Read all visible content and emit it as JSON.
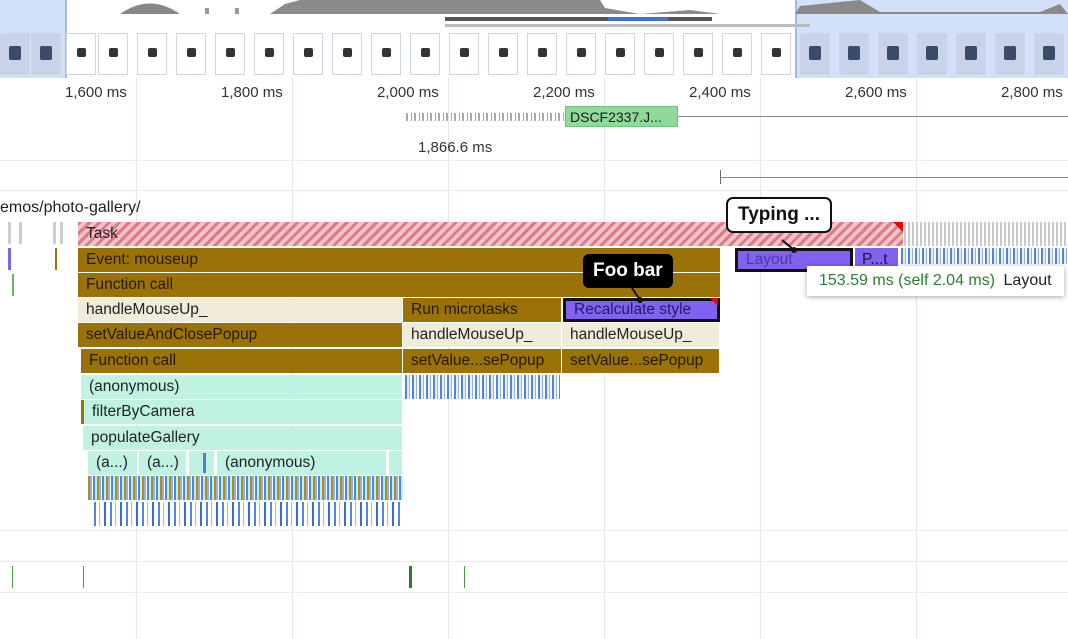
{
  "ruler": {
    "ticks": [
      "1,600 ms",
      "1,800 ms",
      "2,000 ms",
      "2,200 ms",
      "2,400 ms",
      "2,600 ms",
      "2,800 ms"
    ]
  },
  "network": {
    "request_label": "DSCF2337.J...",
    "duration_label": "1,866.6 ms"
  },
  "main_track": {
    "url_label": "emos/photo-gallery/"
  },
  "flame": {
    "task": "Task",
    "event_mouseup": "Event: mouseup",
    "function_call": "Function call",
    "handle_mouse_up_1": "handleMouseUp_",
    "run_microtasks": "Run microtasks",
    "recalculate_style": "Recalculate style",
    "set_value_close_popup": "setValueAndClosePopup",
    "handle_mouse_up_2": "handleMouseUp_",
    "handle_mouse_up_3": "handleMouseUp_",
    "function_call_2": "Function call",
    "set_value_short_1": "setValue...sePopup",
    "set_value_short_2": "setValue...sePopup",
    "anonymous": "(anonymous)",
    "filter_by_camera": "filterByCamera",
    "populate_gallery": "populateGallery",
    "anon_short_1": "(a...)",
    "anon_short_2": "(a...)",
    "anonymous_2": "(anonymous)",
    "layout": "Layout",
    "paint_short": "P...t"
  },
  "annotations": {
    "typing_callout": "Typing ...",
    "foo_bar_callout": "Foo bar"
  },
  "tooltip": {
    "timing": "153.59 ms (self 2.04 ms)",
    "name": "Layout"
  },
  "colors": {
    "scripting": "#9a7207",
    "rendering": "#8162f0",
    "js_frame": "#c0f2e3",
    "network_image": "#8fd99a",
    "timing_text": "#2e7d32"
  }
}
